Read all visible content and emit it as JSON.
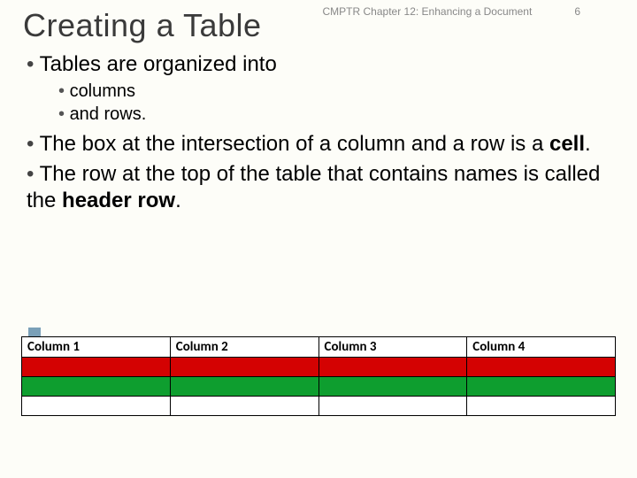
{
  "header": {
    "chapter": "CMPTR Chapter 12: Enhancing a Document",
    "page_number": "6"
  },
  "title": "Creating a Table",
  "bullets": {
    "b1": "Tables are organized into",
    "sub1": "columns",
    "sub2": "and rows.",
    "b2_pre": "The box at the intersection of a column and a row is a ",
    "b2_bold": "cell",
    "b2_post": ".",
    "b3_pre": "The row at the top of the table that contains names is called the ",
    "b3_bold": "header row",
    "b3_post": "."
  },
  "table": {
    "headers": [
      "Column 1",
      "Column 2",
      "Column 3",
      "Column 4"
    ]
  }
}
